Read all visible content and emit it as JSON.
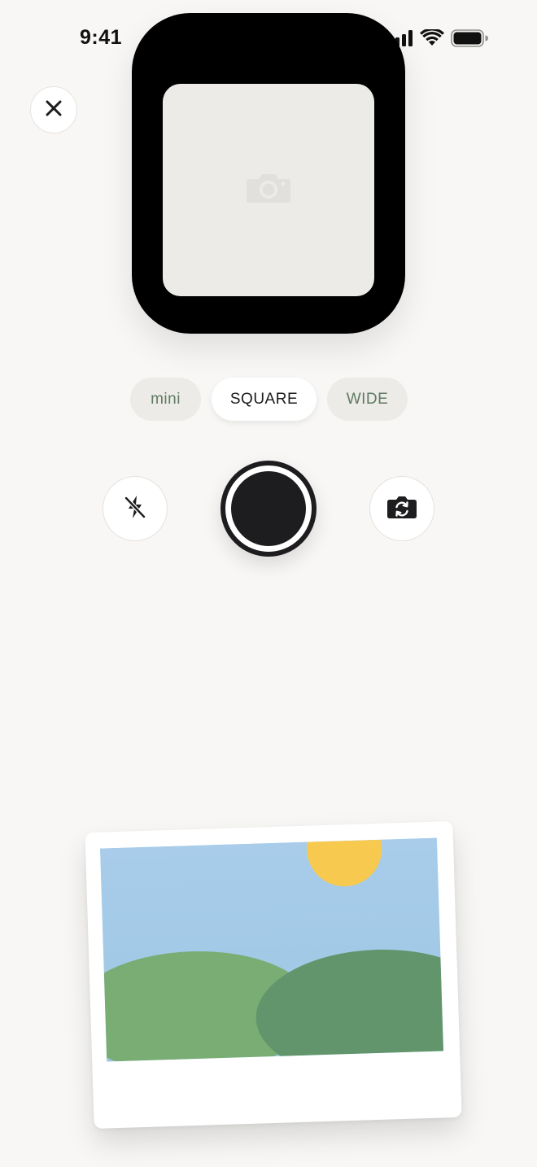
{
  "status_bar": {
    "time": "9:41"
  },
  "icons": {
    "close": "close-icon",
    "camera_placeholder": "camera-icon",
    "flash_off": "flash-off-icon",
    "flip_camera": "flip-camera-icon",
    "signal": "cellular-signal-icon",
    "wifi": "wifi-icon",
    "battery": "battery-icon"
  },
  "formats": [
    {
      "label": "mini",
      "selected": false
    },
    {
      "label": "SQUARE",
      "selected": true
    },
    {
      "label": "WIDE",
      "selected": false
    }
  ],
  "colors": {
    "background": "#f8f7f5",
    "frame": "#000000",
    "viewfinder": "#edebe8",
    "accent_text": "#5f7a62",
    "shutter": "#1d1d1f",
    "sky": "#a4cbe5",
    "sun": "#f8c94f",
    "hill_left": "#7aad74",
    "hill_right": "#62956b"
  }
}
